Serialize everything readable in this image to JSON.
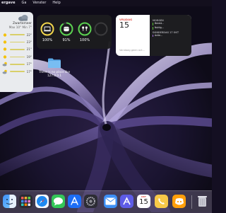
{
  "menubar": {
    "items": [
      "ergave",
      "Ga",
      "Venster",
      "Help"
    ]
  },
  "weather": {
    "city": "Zwartemeer",
    "range": "Max 10° Min 7°",
    "rows": [
      {
        "icon": "sun-icon",
        "temp": "22°"
      },
      {
        "icon": "sun-icon",
        "temp": "23°"
      },
      {
        "icon": "sun-icon",
        "temp": "21°"
      },
      {
        "icon": "sun-icon",
        "temp": "19°"
      },
      {
        "icon": "cloud-sun-icon",
        "temp": "17°"
      },
      {
        "icon": "cloud-sun-icon",
        "temp": "17°"
      }
    ]
  },
  "battery": {
    "devices": [
      {
        "name": "laptop",
        "icon": "laptop-icon",
        "percent": "100%",
        "level": 1.0,
        "color": "#f2d64b"
      },
      {
        "name": "case",
        "icon": "airpods-case-icon",
        "percent": "91%",
        "level": 0.91,
        "color": "#5bd250"
      },
      {
        "name": "airpods",
        "icon": "airpods-icon",
        "percent": "100%",
        "level": 1.0,
        "color": "#5bd250"
      },
      {
        "name": "empty",
        "icon": "",
        "percent": "",
        "level": 0,
        "color": "#3a3a3c"
      }
    ]
  },
  "calendar": {
    "day": "VRIJDAG",
    "date": "15",
    "no_events": "Vandaag geen act...",
    "sections": [
      {
        "heading": "MORGEN",
        "events": [
          {
            "title": "Bereid...",
            "sub": "",
            "color": "#5bc236"
          },
          {
            "title": "Nuttig...",
            "sub": "",
            "color": "#5bc236"
          }
        ]
      },
      {
        "heading": "DONDERDAG 17 OKT",
        "events": [
          {
            "title": "Actie...",
            "sub": "",
            "color": "#a06ad8"
          }
        ]
      }
    ]
  },
  "desktop": {
    "folder_label": "There is no place like 127.0.0.1"
  },
  "dock": {
    "calendar_day": "OKT",
    "calendar_date": "15",
    "colors": {
      "accent": "#e14b41",
      "green": "#5bd250",
      "yellow": "#f2d64b"
    }
  }
}
